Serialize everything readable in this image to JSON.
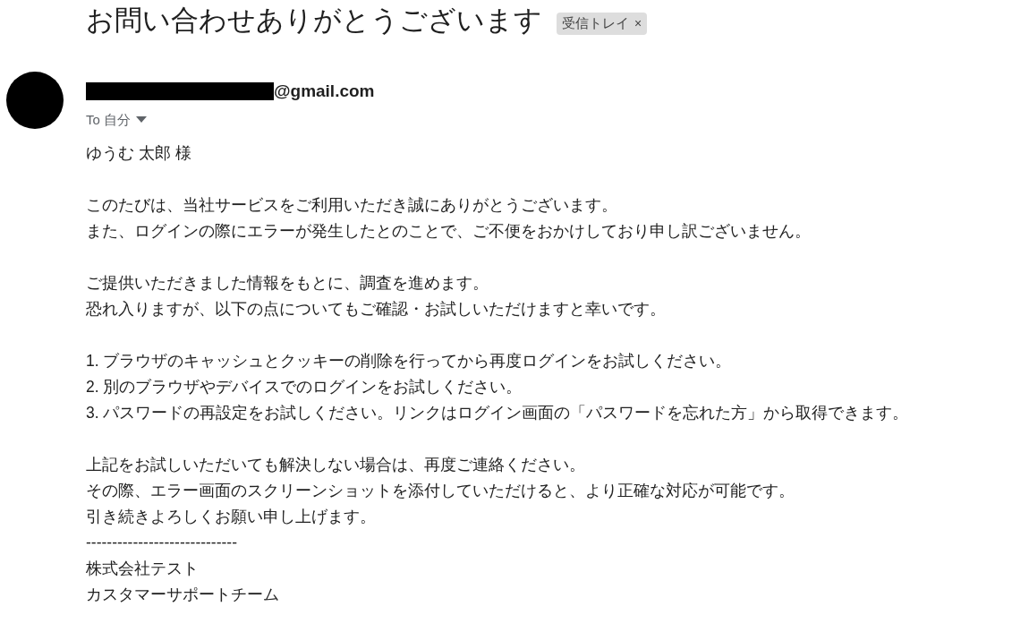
{
  "subject": "お問い合わせありがとうございます",
  "label": {
    "text": "受信トレイ",
    "close": "×"
  },
  "sender": {
    "address_suffix": "@gmail.com",
    "redacted": true
  },
  "recipient": {
    "prefix": "To",
    "name": "自分"
  },
  "paragraphs": [
    [
      "ゆうむ 太郎 様"
    ],
    [
      "このたびは、当社サービスをご利用いただき誠にありがとうございます。",
      "また、ログインの際にエラーが発生したとのことで、ご不便をおかけしており申し訳ございません。"
    ],
    [
      "ご提供いただきました情報をもとに、調査を進めます。",
      "恐れ入りますが、以下の点についてもご確認・お試しいただけますと幸いです。"
    ],
    [
      "1. ブラウザのキャッシュとクッキーの削除を行ってから再度ログインをお試しください。",
      "2. 別のブラウザやデバイスでのログインをお試しください。",
      "3. パスワードの再設定をお試しください。リンクはログイン画面の「パスワードを忘れた方」から取得できます。"
    ],
    [
      "上記をお試しいただいても解決しない場合は、再度ご連絡ください。",
      "その際、エラー画面のスクリーンショットを添付していただけると、より正確な対応が可能です。",
      "引き続きよろしくお願い申し上げます。",
      "-----------------------------",
      "株式会社テスト",
      "カスタマーサポートチーム"
    ]
  ]
}
